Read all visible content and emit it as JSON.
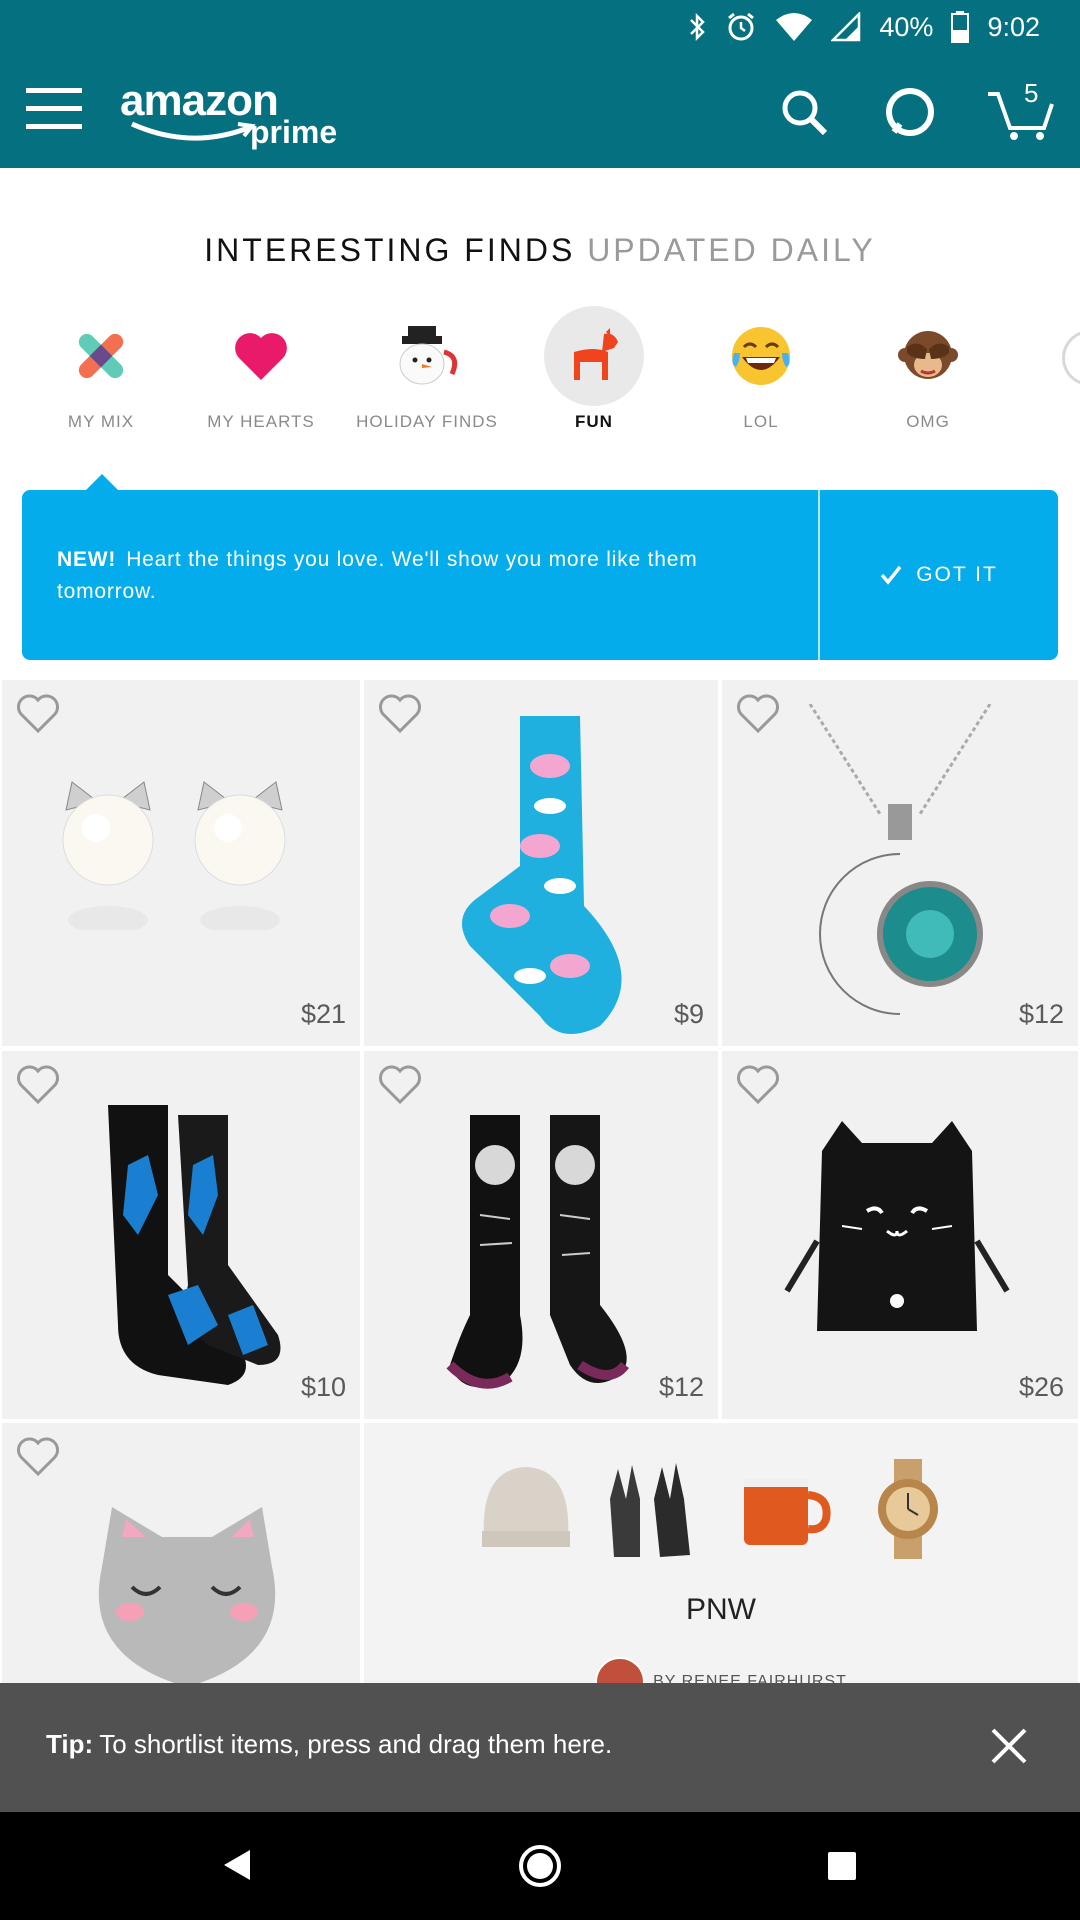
{
  "status_bar": {
    "battery": "40%",
    "time": "9:02"
  },
  "header": {
    "logo_main": "amazon",
    "logo_sub": "prime",
    "cart_count": "5"
  },
  "heading": {
    "strong": "INTERESTING FINDS",
    "light": "UPDATED DAILY"
  },
  "categories": [
    {
      "label": "MY MIX",
      "icon": "mix-icon"
    },
    {
      "label": "MY HEARTS",
      "icon": "heart-icon"
    },
    {
      "label": "HOLIDAY FINDS",
      "icon": "snowman-mug-icon"
    },
    {
      "label": "FUN",
      "icon": "pony-chair-icon",
      "active": true
    },
    {
      "label": "LOL",
      "icon": "laughing-emoji-icon"
    },
    {
      "label": "OMG",
      "icon": "see-no-evil-monkey-icon"
    }
  ],
  "banner": {
    "new_label": "NEW!",
    "message": "Heart the things you love. We'll show you more like them tomorrow.",
    "button": "GOT IT"
  },
  "products": [
    {
      "name": "cat pearl earrings",
      "price": "$21"
    },
    {
      "name": "flying pig socks",
      "price": "$9"
    },
    {
      "name": "moon pendant necklace",
      "price": "$12"
    },
    {
      "name": "dinosaur socks",
      "price": "$10"
    },
    {
      "name": "einstein knee socks",
      "price": "$12"
    },
    {
      "name": "cat backpack",
      "price": "$26"
    },
    {
      "name": "cat plush pillow",
      "price": ""
    }
  ],
  "collection": {
    "title": "PNW",
    "byline": "BY RENEE FAIRHURST"
  },
  "tip": {
    "label": "Tip:",
    "text": "To shortlist items, press and drag them here."
  },
  "colors": {
    "header": "#05707f",
    "banner": "#05aceb",
    "tile": "#f1f1f1"
  }
}
